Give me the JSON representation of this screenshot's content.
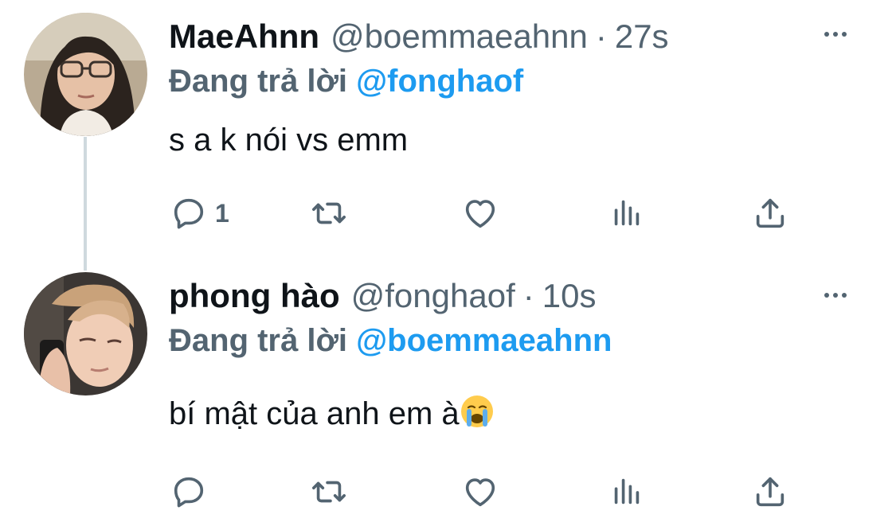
{
  "tweets": [
    {
      "display_name": "MaeAhnn",
      "handle": "@boemmaeahnn",
      "separator": "·",
      "time": "27s",
      "reply_prefix": "Đang trả lời",
      "reply_to": "@fonghaof",
      "text": "s a k nói vs emm",
      "reply_count": "1",
      "avatar_icon": "avatar-woman-glasses"
    },
    {
      "display_name": "phong hào",
      "handle": "@fonghaof",
      "separator": "·",
      "time": "10s",
      "reply_prefix": "Đang trả lời",
      "reply_to": "@boemmaeahnn",
      "text": "bí mật của anh em à",
      "emoji_icon": "loudly-crying-face",
      "reply_count": "",
      "avatar_icon": "avatar-man-phone"
    }
  ],
  "icons": {
    "more": "more-horizontal-icon",
    "reply": "reply-icon",
    "retweet": "retweet-icon",
    "like": "heart-icon",
    "views": "views-bar-chart-icon",
    "share": "share-icon"
  },
  "colors": {
    "text_primary": "#0f1419",
    "text_secondary": "#536471",
    "accent": "#1d9bf0",
    "thread_line": "#cfd9de",
    "background": "#ffffff"
  }
}
